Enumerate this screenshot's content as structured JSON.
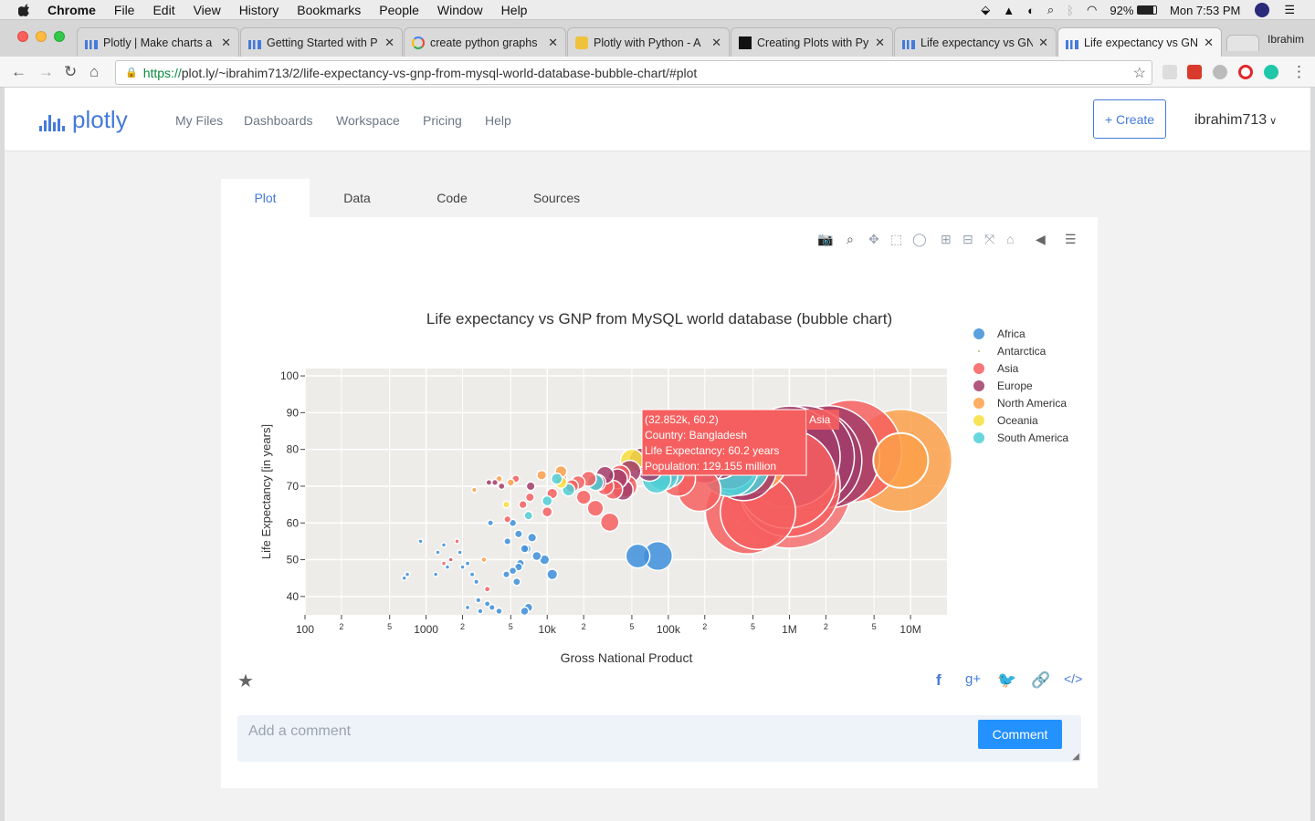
{
  "menubar": {
    "app": "Chrome",
    "items": [
      "File",
      "Edit",
      "View",
      "History",
      "Bookmarks",
      "People",
      "Window",
      "Help"
    ],
    "battery": "92%",
    "clock": "Mon 7:53 PM"
  },
  "tabs": [
    {
      "title": "Plotly | Make charts a",
      "active": false
    },
    {
      "title": "Getting Started with P",
      "active": false
    },
    {
      "title": "create python graphs",
      "active": false
    },
    {
      "title": "Plotly with Python - A",
      "active": false
    },
    {
      "title": "Creating Plots with Py",
      "active": false
    },
    {
      "title": "Life expectancy vs GN",
      "active": false
    },
    {
      "title": "Life expectancy vs GN",
      "active": true
    }
  ],
  "profile": "Ibrahim",
  "address": {
    "scheme": "https://",
    "url": "plot.ly/~ibrahim713/2/life-expectancy-vs-gnp-from-mysql-world-database-bubble-chart/#plot"
  },
  "site": {
    "logo": "plotly",
    "nav": [
      "My Files",
      "Dashboards",
      "Workspace",
      "Pricing",
      "Help"
    ],
    "create": "+ Create",
    "user": "ibrahim713"
  },
  "plot_tabs": [
    "Plot",
    "Data",
    "Code",
    "Sources"
  ],
  "comment": {
    "placeholder": "Add a comment",
    "button": "Comment"
  },
  "colors": {
    "Africa": "#3d8fdb",
    "Antarctica": "#a0c070",
    "Asia": "#f65f5f",
    "Europe": "#a23c6a",
    "North America": "#fca04a",
    "Oceania": "#f7df3c",
    "South America": "#4fcfd6"
  },
  "chart_data": {
    "type": "scatter",
    "subtype": "bubble",
    "title": "Life expectancy vs GNP from MySQL world database (bubble chart)",
    "xlabel": "Gross National Product",
    "ylabel": "Life Expectancy [in years]",
    "xscale": "log",
    "xlim": [
      100,
      20000000
    ],
    "ylim": [
      35,
      102
    ],
    "x_ticks": [
      {
        "v": 100,
        "t": "100",
        "major": true
      },
      {
        "v": 200,
        "t": "2",
        "major": false
      },
      {
        "v": 500,
        "t": "5",
        "major": false
      },
      {
        "v": 1000,
        "t": "1000",
        "major": true
      },
      {
        "v": 2000,
        "t": "2",
        "major": false
      },
      {
        "v": 5000,
        "t": "5",
        "major": false
      },
      {
        "v": 10000,
        "t": "10k",
        "major": true
      },
      {
        "v": 20000,
        "t": "2",
        "major": false
      },
      {
        "v": 50000,
        "t": "5",
        "major": false
      },
      {
        "v": 100000,
        "t": "100k",
        "major": true
      },
      {
        "v": 200000,
        "t": "2",
        "major": false
      },
      {
        "v": 500000,
        "t": "5",
        "major": false
      },
      {
        "v": 1000000,
        "t": "1M",
        "major": true
      },
      {
        "v": 2000000,
        "t": "2",
        "major": false
      },
      {
        "v": 5000000,
        "t": "5",
        "major": false
      },
      {
        "v": 10000000,
        "t": "10M",
        "major": true
      }
    ],
    "y_ticks": [
      40,
      50,
      60,
      70,
      80,
      90,
      100
    ],
    "legend_position": "right",
    "series": [
      {
        "name": "Africa",
        "points": [
          [
            660,
            45
          ],
          [
            700,
            46
          ],
          [
            1200,
            46
          ],
          [
            1500,
            48
          ],
          [
            1600,
            50
          ],
          [
            1900,
            52
          ],
          [
            2000,
            48
          ],
          [
            2200,
            49
          ],
          [
            2400,
            46
          ],
          [
            2600,
            44
          ],
          [
            2700,
            39
          ],
          [
            2200,
            37
          ],
          [
            2800,
            36
          ],
          [
            3500,
            37
          ],
          [
            4000,
            36
          ],
          [
            3200,
            38
          ],
          [
            4600,
            46
          ],
          [
            5200,
            47
          ],
          [
            5600,
            44
          ],
          [
            5800,
            48
          ],
          [
            6000,
            49
          ],
          [
            6500,
            53
          ],
          [
            6800,
            53
          ],
          [
            7500,
            56
          ],
          [
            8200,
            51
          ],
          [
            11000,
            46
          ],
          [
            9500,
            50
          ],
          [
            6500,
            36
          ],
          [
            7000,
            37
          ],
          [
            4700,
            55
          ],
          [
            5200,
            60
          ],
          [
            5800,
            57
          ],
          [
            56000,
            51
          ],
          [
            82000,
            51
          ],
          [
            1400,
            54
          ],
          [
            1250,
            52
          ],
          [
            900,
            55
          ],
          [
            3400,
            60
          ]
        ]
      },
      {
        "name": "Antarctica",
        "points": []
      },
      {
        "name": "Asia",
        "points": [
          [
            32852,
            60.2
          ],
          [
            4700,
            61
          ],
          [
            6300,
            65
          ],
          [
            7200,
            67
          ],
          [
            10000,
            63
          ],
          [
            11000,
            68
          ],
          [
            13000,
            72
          ],
          [
            16000,
            70
          ],
          [
            18000,
            71
          ],
          [
            20000,
            67
          ],
          [
            22000,
            72
          ],
          [
            25000,
            64
          ],
          [
            30000,
            70
          ],
          [
            35000,
            69
          ],
          [
            40000,
            73
          ],
          [
            45000,
            70
          ],
          [
            120000,
            72
          ],
          [
            180000,
            69
          ],
          [
            550000,
            63
          ],
          [
            950000,
            72
          ],
          [
            1000000,
            70
          ],
          [
            3200000,
            79.5
          ],
          [
            1800,
            55
          ],
          [
            1600,
            50
          ],
          [
            1400,
            49
          ],
          [
            5500,
            72
          ],
          [
            3200,
            42
          ]
        ]
      },
      {
        "name": "Europe",
        "points": [
          [
            3300,
            71
          ],
          [
            3700,
            71
          ],
          [
            4200,
            70
          ],
          [
            7300,
            70
          ],
          [
            26000,
            71
          ],
          [
            30000,
            73
          ],
          [
            38000,
            72
          ],
          [
            42000,
            69
          ],
          [
            48000,
            74
          ],
          [
            60000,
            77
          ],
          [
            70000,
            75
          ],
          [
            90000,
            74
          ],
          [
            110000,
            78
          ],
          [
            150000,
            78
          ],
          [
            200000,
            77
          ],
          [
            260000,
            79
          ],
          [
            320000,
            77
          ],
          [
            420000,
            75
          ],
          [
            1000000,
            78
          ],
          [
            1300000,
            78
          ],
          [
            1500000,
            77
          ],
          [
            2100000,
            78
          ]
        ]
      },
      {
        "name": "North America",
        "points": [
          [
            8300000,
            77
          ],
          [
            500000,
            78
          ],
          [
            4000,
            72
          ],
          [
            2500,
            69
          ],
          [
            5000,
            71
          ],
          [
            9000,
            73
          ],
          [
            13000,
            74
          ],
          [
            3000,
            50
          ]
        ]
      },
      {
        "name": "Oceania",
        "points": [
          [
            380000,
            79
          ],
          [
            50000,
            77
          ],
          [
            4600,
            65
          ],
          [
            13000,
            71
          ]
        ]
      },
      {
        "name": "South America",
        "points": [
          [
            90000,
            73
          ],
          [
            100000,
            74
          ],
          [
            320000,
            75
          ],
          [
            380000,
            76
          ],
          [
            12000,
            72
          ],
          [
            25000,
            71
          ],
          [
            80000,
            72
          ],
          [
            15000,
            69
          ],
          [
            7000,
            62
          ],
          [
            10000,
            66
          ]
        ]
      }
    ],
    "hover": {
      "lines": [
        "(32.852k, 60.2)",
        "Country: Bangladesh",
        "Life Expectancy: 60.2 years",
        "Population: 129.155 million"
      ],
      "label": "Asia"
    }
  }
}
